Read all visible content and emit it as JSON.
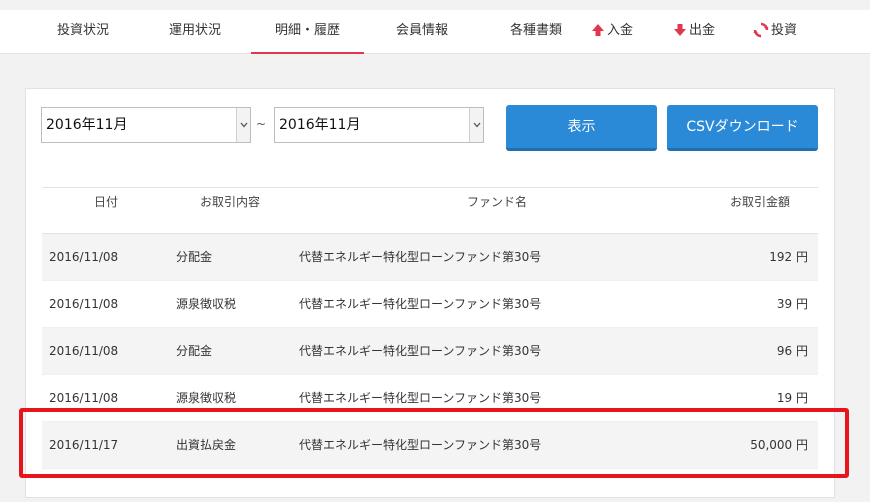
{
  "nav": {
    "items": [
      {
        "label": "投資状況"
      },
      {
        "label": "運用状況"
      },
      {
        "label": "明細・履歴",
        "active": true
      },
      {
        "label": "会員情報"
      },
      {
        "label": "各種書類"
      },
      {
        "label": "入金",
        "icon": "arrow-up-icon"
      },
      {
        "label": "出金",
        "icon": "arrow-down-icon"
      },
      {
        "label": "投資",
        "icon": "refresh-icon"
      }
    ],
    "accent_color": "#e0364e"
  },
  "filter": {
    "from_value": "2016年11月",
    "to_value": "2016年11月",
    "range_separator": "~",
    "display_button": "表示",
    "csv_button": "CSVダウンロード"
  },
  "table": {
    "headers": {
      "date": "日付",
      "type": "お取引内容",
      "fund": "ファンド名",
      "amount": "お取引金額"
    },
    "rows": [
      {
        "date": "2016/11/08",
        "type": "分配金",
        "fund": "代替エネルギー特化型ローンファンド第30号",
        "amount": "192 円"
      },
      {
        "date": "2016/11/08",
        "type": "源泉徴収税",
        "fund": "代替エネルギー特化型ローンファンド第30号",
        "amount": "39 円"
      },
      {
        "date": "2016/11/08",
        "type": "分配金",
        "fund": "代替エネルギー特化型ローンファンド第30号",
        "amount": "96 円"
      },
      {
        "date": "2016/11/08",
        "type": "源泉徴収税",
        "fund": "代替エネルギー特化型ローンファンド第30号",
        "amount": "19 円"
      },
      {
        "date": "2016/11/17",
        "type": "出資払戻金",
        "fund": "代替エネルギー特化型ローンファンド第30号",
        "amount": "50,000 円"
      }
    ]
  },
  "colors": {
    "button_blue": "#2b8ad8",
    "highlight_red": "#e8141b"
  }
}
